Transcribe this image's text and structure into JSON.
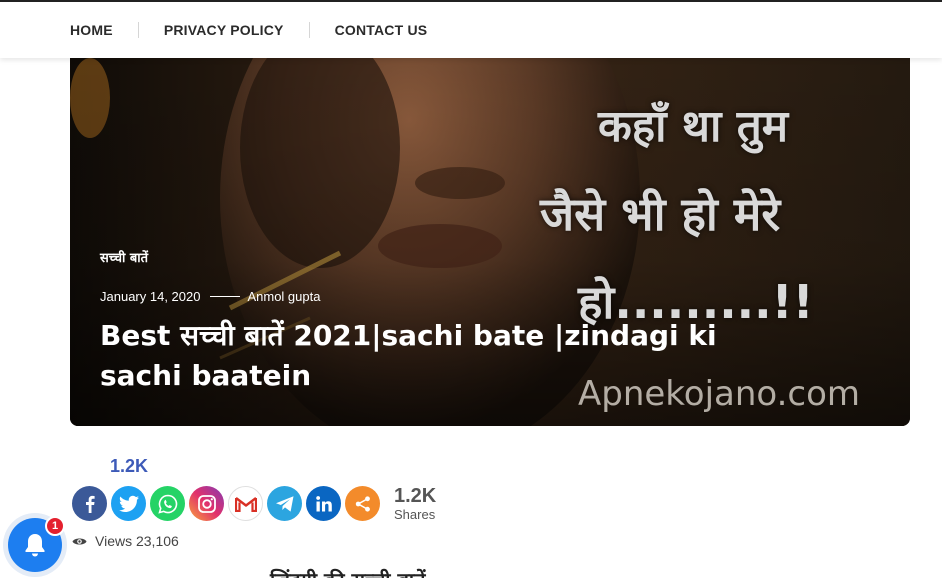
{
  "nav": {
    "items": [
      {
        "label": "HOME"
      },
      {
        "label": "PRIVACY POLICY"
      },
      {
        "label": "CONTACT US"
      }
    ]
  },
  "hero": {
    "image_text": {
      "line1": "कहाँ था तुम",
      "line2": "जैसे भी हो मेरे",
      "line3": "हो.........!!",
      "site": "Apnekojano.com"
    },
    "category": "सच्ची बातें",
    "date": "January 14, 2020",
    "author": "Anmol gupta",
    "title": "Best सच्ची बातें 2021|sachi bate |zindagi ki sachi baatein"
  },
  "share": {
    "total_top": "1.2K",
    "total": "1.2K",
    "total_label": "Shares",
    "buttons": [
      {
        "name": "facebook",
        "color": "#3b5998"
      },
      {
        "name": "twitter",
        "color": "#1da1f2"
      },
      {
        "name": "whatsapp",
        "color": "#25d366"
      },
      {
        "name": "instagram",
        "color": "#c13584"
      },
      {
        "name": "gmail",
        "color": "#ffffff"
      },
      {
        "name": "telegram",
        "color": "#2ca5e0"
      },
      {
        "name": "linkedin",
        "color": "#0a66c2"
      },
      {
        "name": "more-share",
        "color": "#f38b2b"
      }
    ]
  },
  "views": {
    "label": "Views 23,106"
  },
  "notification": {
    "badge_count": "1",
    "color": "#1d7ef0"
  },
  "body_partial_text": "ज़िंदगी की सच्ची बातें"
}
